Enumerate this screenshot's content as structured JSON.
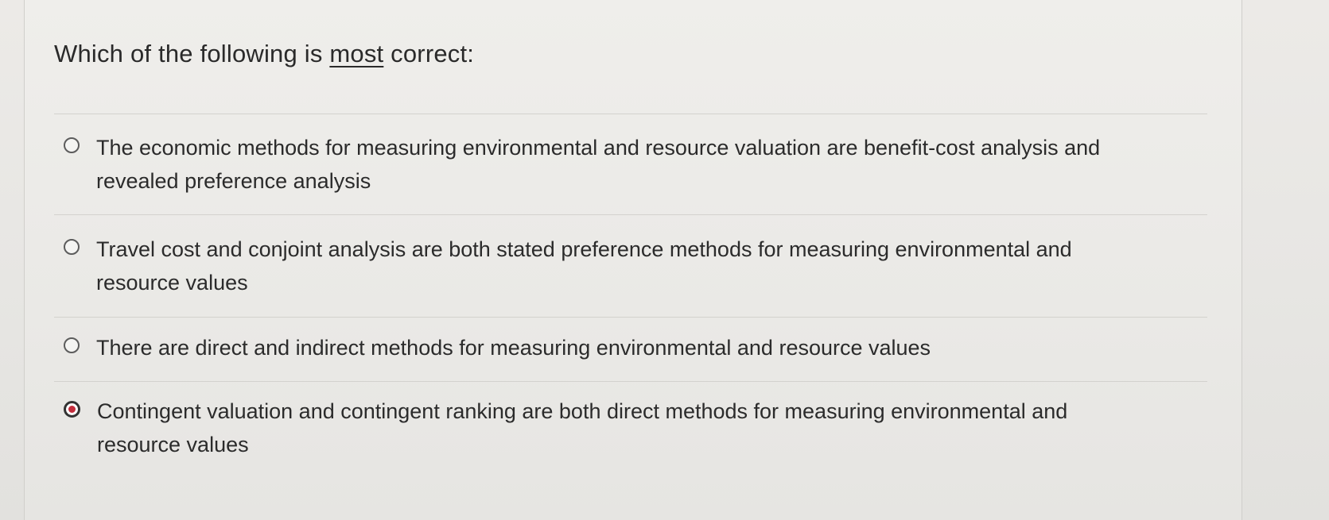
{
  "question": {
    "prefix": "Which of the following is ",
    "emphasis": "most",
    "suffix": " correct:"
  },
  "options": [
    {
      "label": "The economic methods for measuring environmental and resource valuation are benefit-cost analysis and revealed preference analysis",
      "selected": false
    },
    {
      "label": "Travel cost and conjoint analysis are both stated preference methods for measuring environmental and resource values",
      "selected": false
    },
    {
      "label": "There are direct and indirect methods for measuring environmental and resource values",
      "selected": false
    },
    {
      "label": "Contingent valuation and contingent ranking are both direct methods for measuring environmental and resource values",
      "selected": true
    }
  ],
  "colors": {
    "selected_radio": "#c42d3c",
    "background": "#eceae7"
  }
}
